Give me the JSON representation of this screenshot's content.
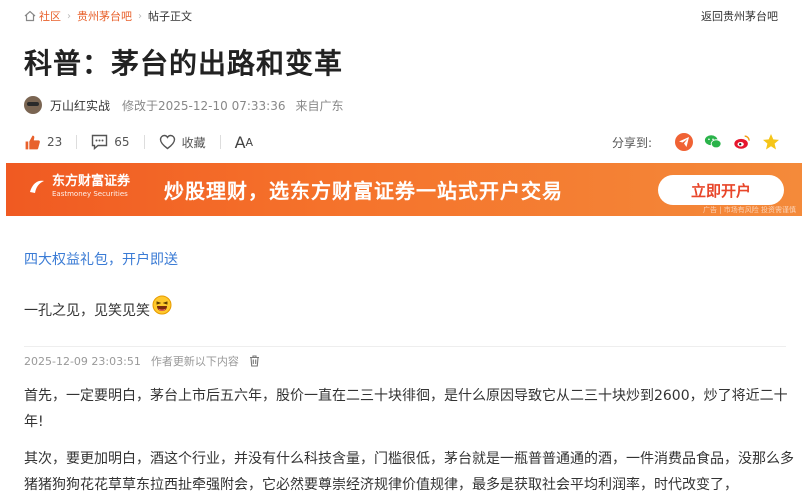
{
  "breadcrumb": {
    "community": "社区",
    "forum": "贵州茅台吧",
    "current": "帖子正文",
    "back": "返回贵州茅台吧"
  },
  "post": {
    "title": "科普：茅台的出路和变革",
    "author": "万山红实战",
    "modified": "修改于2025-12-10 07:33:36",
    "source": "来自广东"
  },
  "actions": {
    "likes": "23",
    "comments": "65",
    "favorite": "收藏",
    "font_big": "A",
    "font_small": "A",
    "share_label": "分享到:"
  },
  "banner": {
    "brand": "东方财富证券",
    "brand_en": "Eastmoney Securities",
    "slogan": "炒股理财，选东方财富证券一站式开户交易",
    "cta": "立即开户",
    "ad_note": "广告 | 市场有风险 投资需谨慎"
  },
  "promo_link": "四大权益礼包，开户即送",
  "content": {
    "intro": "一孔之见，见笑见笑",
    "update_time": "2025-12-09 23:03:51",
    "update_note": "作者更新以下内容",
    "para1": "首先，一定要明白，茅台上市后五六年，股价一直在二三十块徘徊，是什么原因导致它从二三十块炒到2600，炒了将近二十年!",
    "para2": "其次，要更加明白，酒这个行业，并没有什么科技含量，门槛很低，茅台就是一瓶普普通通的酒，一件消费品食品，没那么多猪猪狗狗花花草草东拉西扯牵强附会，它必然要尊崇经济规律价值规律，最多是获取社会平均利润率，时代改变了，"
  },
  "colors": {
    "accent": "#e8612c",
    "link": "#3a7bd5",
    "banner": "#f05a22"
  }
}
